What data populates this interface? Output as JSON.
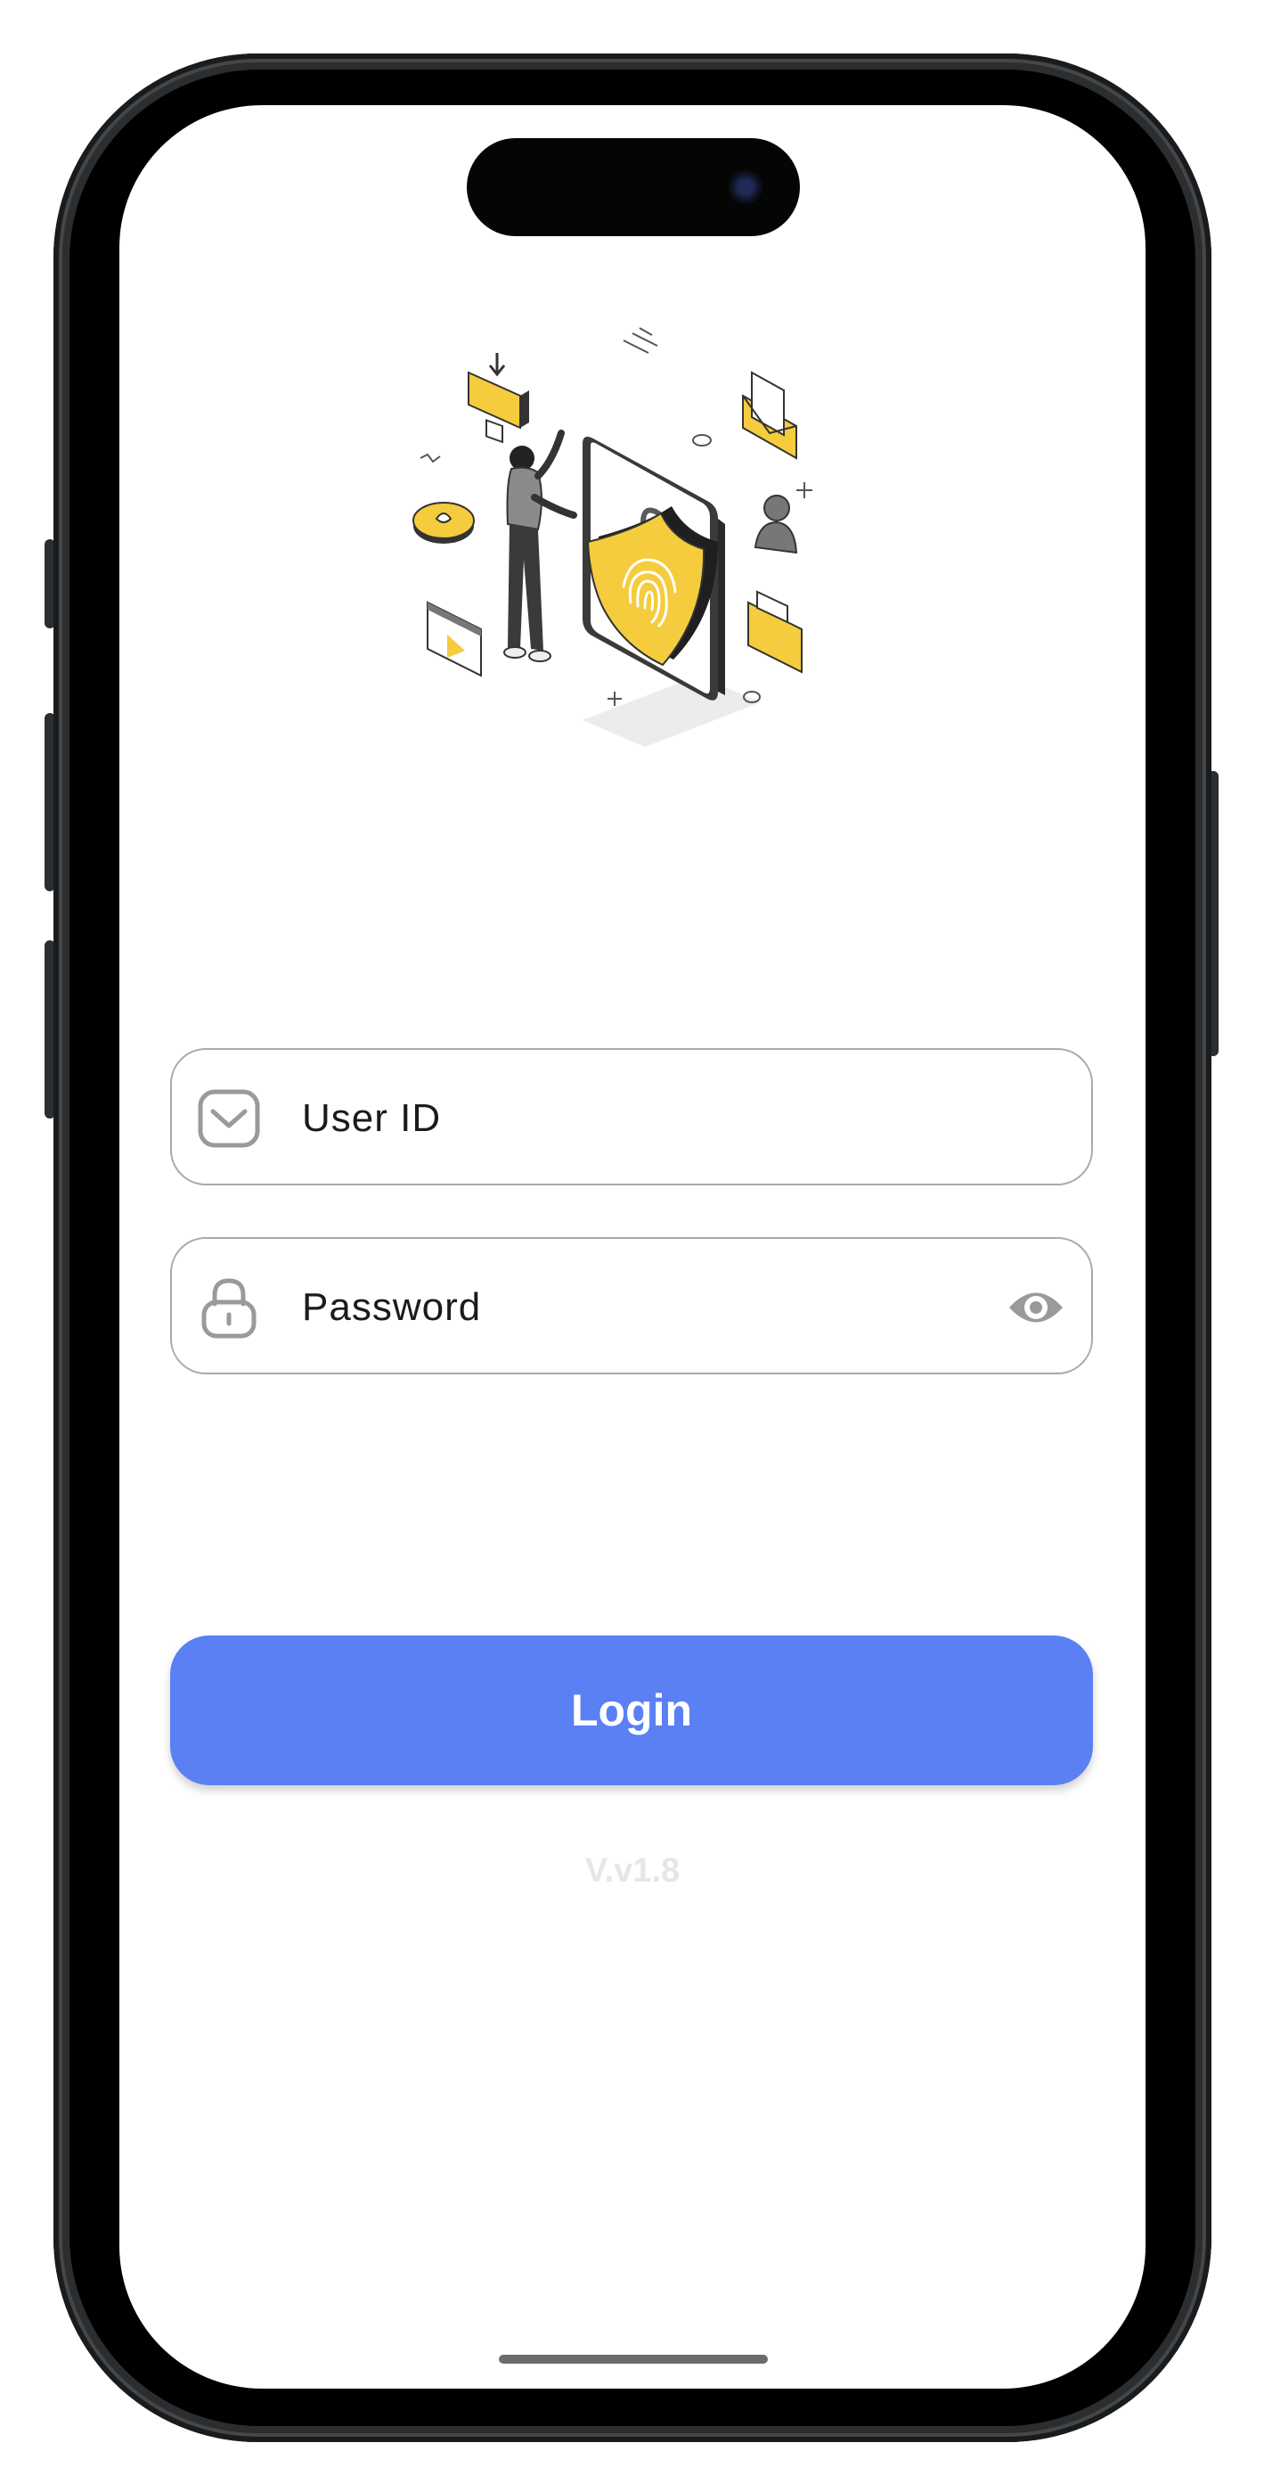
{
  "login_form": {
    "user_id_placeholder": "User ID",
    "password_placeholder": "Password",
    "login_label": "Login"
  },
  "footer": {
    "version": "V.v1.8"
  },
  "icons": {
    "user_field": "envelope-icon",
    "password_field": "lock-icon",
    "password_toggle": "eye-icon",
    "hero": "security-illustration"
  },
  "colors": {
    "primary": "#5a80f3",
    "field_border": "#a9a9a9",
    "icon_gray": "#9a9a9a",
    "illustration_accent": "#f5cc3d",
    "version_text": "#e6e6e6"
  }
}
